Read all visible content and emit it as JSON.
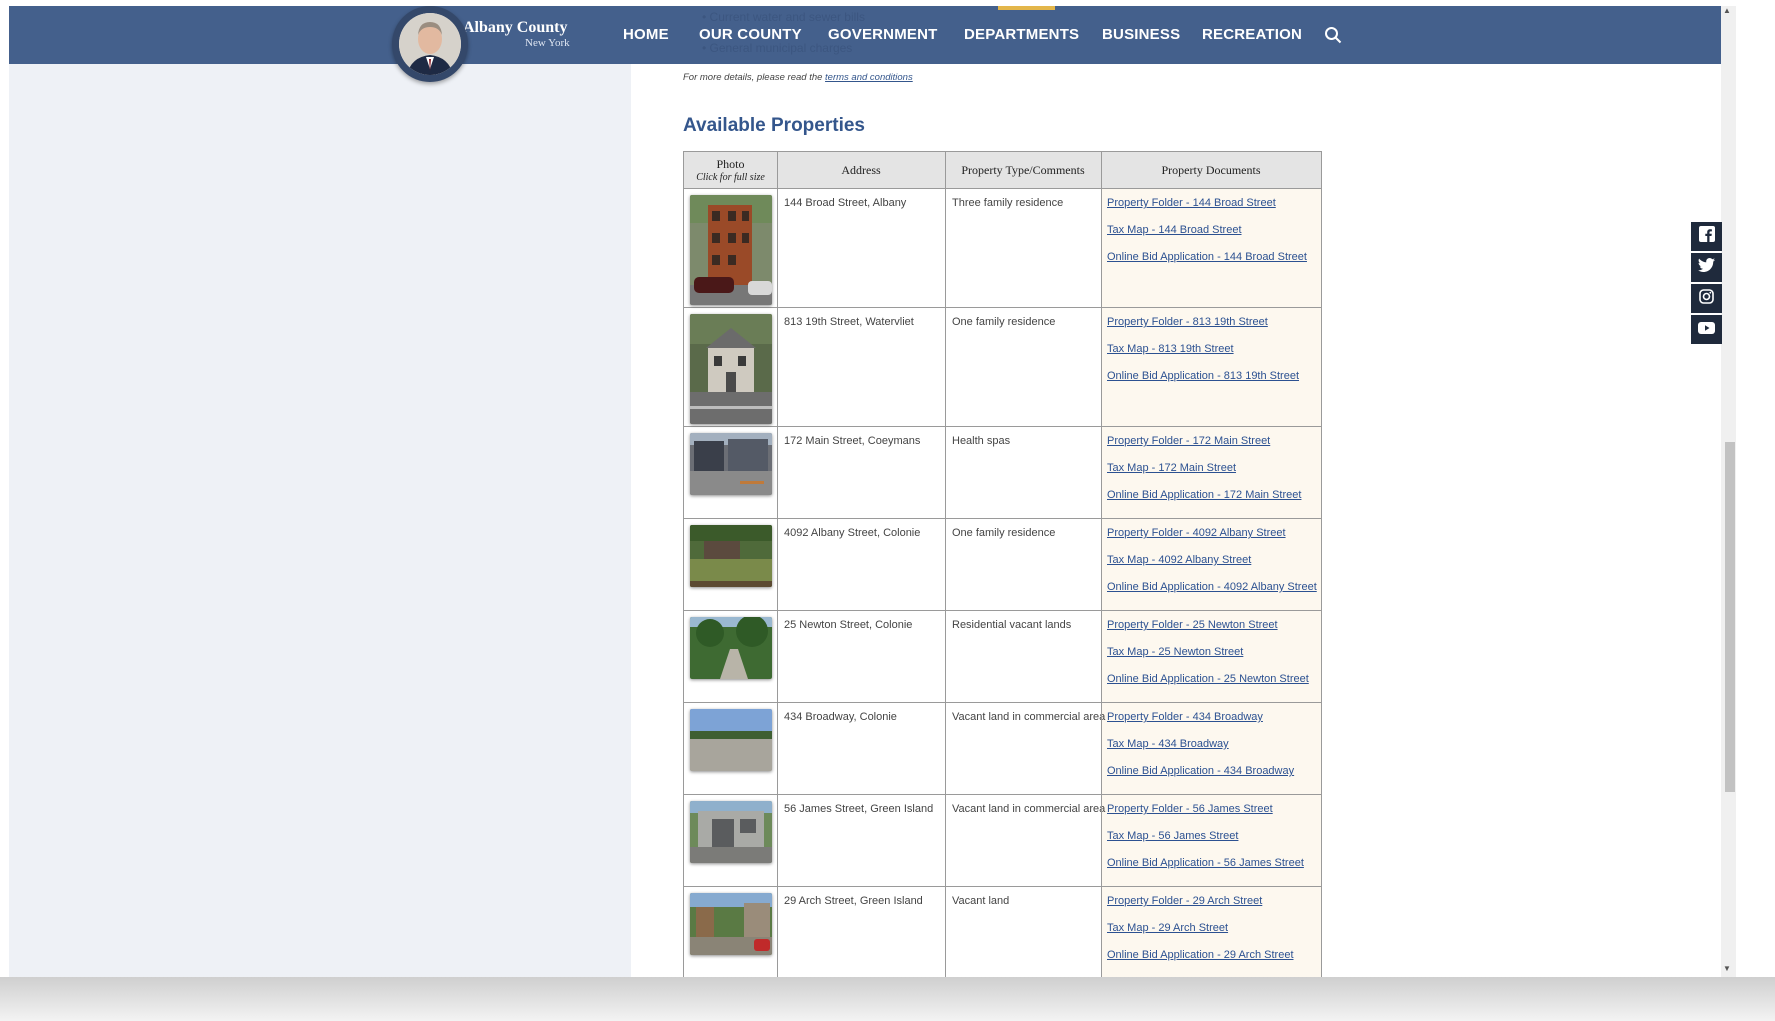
{
  "header": {
    "brand_title": "Albany County",
    "brand_subtitle": "New York",
    "ghost_items": [
      "Current water and sewer bills",
      "",
      "General municipal charges"
    ],
    "nav": [
      {
        "label": "HOME"
      },
      {
        "label": "OUR COUNTY"
      },
      {
        "label": "GOVERNMENT"
      },
      {
        "label": "DEPARTMENTS"
      },
      {
        "label": "BUSINESS"
      },
      {
        "label": "RECREATION"
      }
    ],
    "accent_color": "#e3b64a",
    "bar_color": "#44608c"
  },
  "main": {
    "details_prefix": "For more details, please read the",
    "details_link": "terms and conditions",
    "section_title": "Available Properties"
  },
  "table": {
    "headers": {
      "photo": "Photo",
      "photo_sub": "Click for full size",
      "address": "Address",
      "type": "Property Type/Comments",
      "docs": "Property Documents"
    },
    "rows": [
      {
        "address": "144 Broad Street, Albany",
        "type": "Three family residence",
        "docs": [
          "Property Folder - 144 Broad Street",
          "Tax Map - 144 Broad Street",
          "Online Bid Application - 144 Broad Street"
        ]
      },
      {
        "address": "813 19th Street, Watervliet",
        "type": "One family residence",
        "docs": [
          "Property Folder - 813 19th Street",
          "Tax Map - 813 19th Street",
          "Online Bid Application - 813 19th Street"
        ]
      },
      {
        "address": "172 Main Street, Coeymans",
        "type": "Health spas",
        "docs": [
          "Property Folder - 172 Main Street",
          "Tax Map - 172 Main Street",
          "Online Bid Application - 172 Main Street"
        ]
      },
      {
        "address": "4092 Albany Street, Colonie",
        "type": "One family residence",
        "docs": [
          "Property Folder - 4092 Albany Street",
          "Tax Map - 4092 Albany Street",
          "Online Bid Application - 4092 Albany Street"
        ]
      },
      {
        "address": "25 Newton Street, Colonie",
        "type": "Residential vacant lands",
        "docs": [
          "Property Folder - 25 Newton Street",
          "Tax Map - 25 Newton Street",
          "Online Bid Application - 25 Newton Street"
        ]
      },
      {
        "address": "434 Broadway, Colonie",
        "type": "Vacant land in commercial area",
        "docs": [
          "Property Folder - 434 Broadway",
          "Tax Map - 434 Broadway",
          "Online Bid Application - 434 Broadway"
        ]
      },
      {
        "address": "56 James Street, Green Island",
        "type": "Vacant land in commercial area",
        "docs": [
          "Property Folder - 56 James Street",
          "Tax Map - 56 James Street",
          "Online Bid Application - 56 James Street"
        ]
      },
      {
        "address": "29 Arch Street, Green Island",
        "type": "Vacant land",
        "docs": [
          "Property Folder - 29 Arch Street",
          "Tax Map - 29 Arch Street",
          "Online Bid Application - 29 Arch Street"
        ]
      }
    ]
  },
  "social": [
    {
      "icon": "facebook-icon"
    },
    {
      "icon": "twitter-icon"
    },
    {
      "icon": "instagram-icon"
    },
    {
      "icon": "youtube-icon"
    }
  ]
}
